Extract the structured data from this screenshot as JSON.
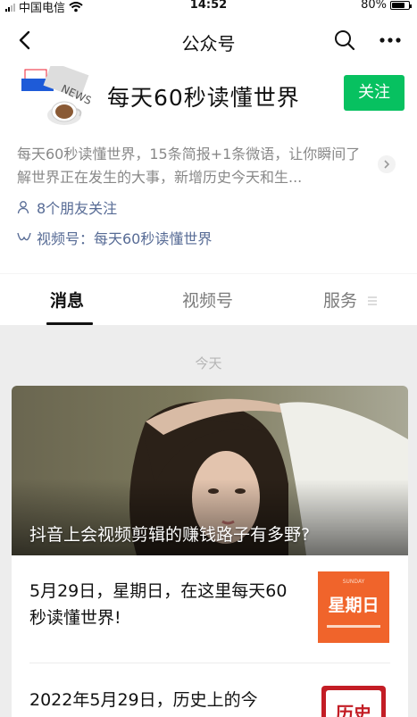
{
  "status_bar": {
    "carrier": "中国电信",
    "time": "14:52",
    "battery": "80%",
    "battery_level": 0.8
  },
  "nav": {
    "title": "公众号",
    "back_icon": "chevron-left-icon",
    "search_icon": "search-icon",
    "more_icon": "more-icon"
  },
  "profile": {
    "name": "每天60秒读懂世界",
    "follow_label": "关注",
    "description": "每天60秒读懂世界，15条简报+1条微语，让你瞬间了解世界正在发生的大事，新增历史今天和生...",
    "friends_text": "8个朋友关注",
    "channels_text": "视频号：每天60秒读懂世界",
    "avatar_text": "NEWS",
    "colors": {
      "follow": "#07c160",
      "link": "#576b95"
    }
  },
  "tabs": [
    {
      "label": "消息",
      "active": true
    },
    {
      "label": "视频号",
      "active": false
    },
    {
      "label": "服务",
      "active": false
    }
  ],
  "feed": {
    "date_label": "今天",
    "cover_title": "抖音上会视频剪辑的赚钱路子有多野?",
    "items": [
      {
        "text": "5月29日，星期日，在这里每天60秒读懂世界!",
        "thumb_title": "星期日",
        "thumb_sub": "SUNDAY"
      },
      {
        "text": "2022年5月29日，历史上的今",
        "thumb_title": "历史"
      }
    ]
  }
}
